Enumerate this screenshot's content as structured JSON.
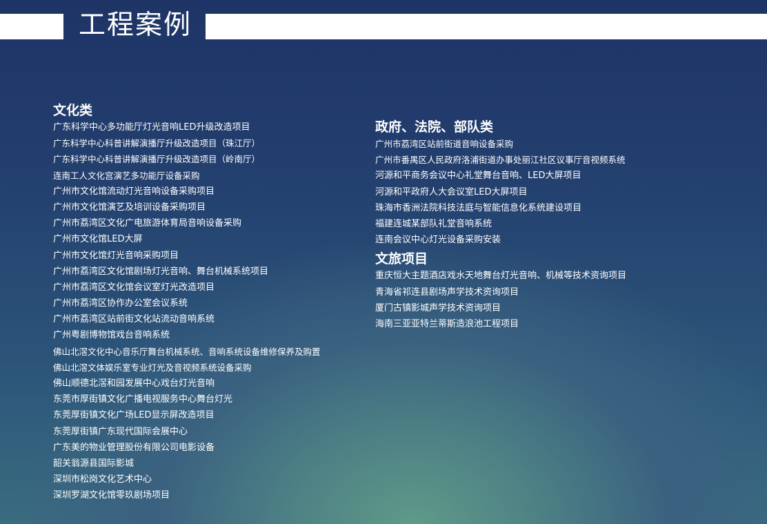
{
  "header": {
    "title": "工程案例"
  },
  "sections": {
    "culture": {
      "title": "文化类",
      "items": [
        {
          "text": "广东科学中心多功能厅灯光音响LED升级改造项目",
          "style": "sans"
        },
        {
          "text": "广东科学中心科普讲解演播厅升级改造项目（珠江厅）",
          "style": "serif"
        },
        {
          "text": "广东科学中心科普讲解演播厅升级改造项目（岭南厅）",
          "style": "serif"
        },
        {
          "text": "连南工人文化宫演艺多功能厅设备采购",
          "style": "serif"
        },
        {
          "text": "广州市文化馆流动灯光音响设备采购项目",
          "style": "sans"
        },
        {
          "text": "广州市文化馆演艺及培训设备采购项目",
          "style": "sans"
        },
        {
          "text": "广州市荔湾区文化广电旅游体育局音响设备采购",
          "style": "sans"
        },
        {
          "text": "广州市文化馆LED大屏",
          "style": "sans"
        },
        {
          "text": "广州市文化馆灯光音响采购项目",
          "style": "sans"
        },
        {
          "text": "广州市荔湾区文化馆剧场灯光音响、舞台机械系统项目",
          "style": "sans"
        },
        {
          "text": "广州市荔湾区文化馆会议室灯光改造项目",
          "style": "sans"
        },
        {
          "text": "广州市荔湾区协作办公室会议系统",
          "style": "sans"
        },
        {
          "text": "广州市荔湾区站前街文化站流动音响系统",
          "style": "sans"
        },
        {
          "text": "广州粤剧博物馆戏台音响系统",
          "style": "sans"
        },
        {
          "text": "佛山北滘文化中心音乐厅舞台机械系统、音响系统设备维修保养及购置",
          "style": "serif"
        },
        {
          "text": "佛山北滘文体娱乐室专业灯光及音视频系统设备采购",
          "style": "serif"
        },
        {
          "text": "佛山顺德北滘和园发展中心戏台灯光音响",
          "style": "sans"
        },
        {
          "text": "东莞市厚街镇文化广播电视服务中心舞台灯光",
          "style": "sans"
        },
        {
          "text": "东莞厚街镇文化广场LED显示屏改造项目",
          "style": "sans"
        },
        {
          "text": "东莞厚街镇广东现代国际会展中心",
          "style": "sans"
        },
        {
          "text": "广东美的物业管理股份有限公司电影设备",
          "style": "sans"
        },
        {
          "text": "韶关翁源县国际影城",
          "style": "sans"
        },
        {
          "text": "深圳市松岗文化艺术中心",
          "style": "sans"
        },
        {
          "text": "深圳罗湖文化馆零玖剧场项目",
          "style": "sans"
        }
      ]
    },
    "government": {
      "title": "政府、法院、部队类",
      "items": [
        {
          "text": "广州市荔湾区站前街道音响设备采购",
          "style": "serif"
        },
        {
          "text": "广州市番禺区人民政府洛浦街道办事处丽江社区议事厅音视频系统",
          "style": "serif"
        },
        {
          "text": "河源和平商务会议中心礼堂舞台音响、LED大屏项目",
          "style": "sans"
        },
        {
          "text": "河源和平政府人大会议室LED大屏项目",
          "style": "sans"
        },
        {
          "text": "珠海市香洲法院科技法庭与智能信息化系统建设项目",
          "style": "sans"
        },
        {
          "text": "福建连城某部队礼堂音响系统",
          "style": "sans"
        },
        {
          "text": "连南会议中心灯光设备采购安装",
          "style": "sans"
        }
      ]
    },
    "tourism": {
      "title": "文旅项目",
      "items": [
        {
          "text": "重庆恒大主题酒店戏水天地舞台灯光音响、机械等技术资询项目",
          "style": "sans"
        },
        {
          "text": "青海省祁连县剧场声学技术资询项目",
          "style": "sans"
        },
        {
          "text": "厦门古镇影城声学技术资询项目",
          "style": "sans"
        },
        {
          "text": "海南三亚亚特兰蒂斯造浪池工程项目",
          "style": "sans"
        }
      ]
    }
  }
}
